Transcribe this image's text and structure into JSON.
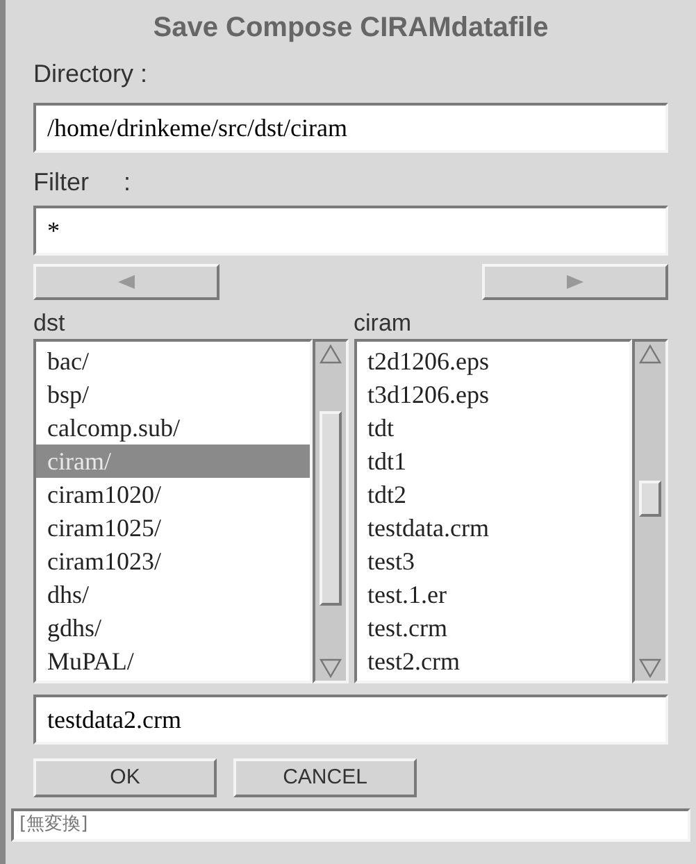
{
  "window": {
    "title": "Save Compose CIRAMdatafile"
  },
  "directory": {
    "label": "Directory :",
    "value": "/home/drinkeme/src/dst/ciram"
  },
  "filter": {
    "label": "Filter     :",
    "value": "*"
  },
  "directories": {
    "label": "dst",
    "items": [
      {
        "name": "bac/",
        "selected": false
      },
      {
        "name": "bsp/",
        "selected": false
      },
      {
        "name": "calcomp.sub/",
        "selected": false
      },
      {
        "name": "ciram/",
        "selected": true
      },
      {
        "name": "ciram1020/",
        "selected": false
      },
      {
        "name": "ciram1025/",
        "selected": false
      },
      {
        "name": "ciram1023/",
        "selected": false
      },
      {
        "name": "dhs/",
        "selected": false
      },
      {
        "name": "gdhs/",
        "selected": false
      },
      {
        "name": "MuPAL/",
        "selected": false
      }
    ]
  },
  "files": {
    "label": "ciram",
    "items": [
      {
        "name": "t2d1206.eps",
        "selected": false
      },
      {
        "name": "t3d1206.eps",
        "selected": false
      },
      {
        "name": "tdt",
        "selected": false
      },
      {
        "name": "tdt1",
        "selected": false
      },
      {
        "name": "tdt2",
        "selected": false
      },
      {
        "name": "testdata.crm",
        "selected": false
      },
      {
        "name": "test3",
        "selected": false
      },
      {
        "name": "test.1.er",
        "selected": false
      },
      {
        "name": "test.crm",
        "selected": false
      },
      {
        "name": "test2.crm",
        "selected": false
      }
    ]
  },
  "filename": {
    "value": "testdata2.crm"
  },
  "buttons": [
    "OK",
    "CANCEL"
  ],
  "status_bar": {
    "input_mode": "[無変換]"
  }
}
